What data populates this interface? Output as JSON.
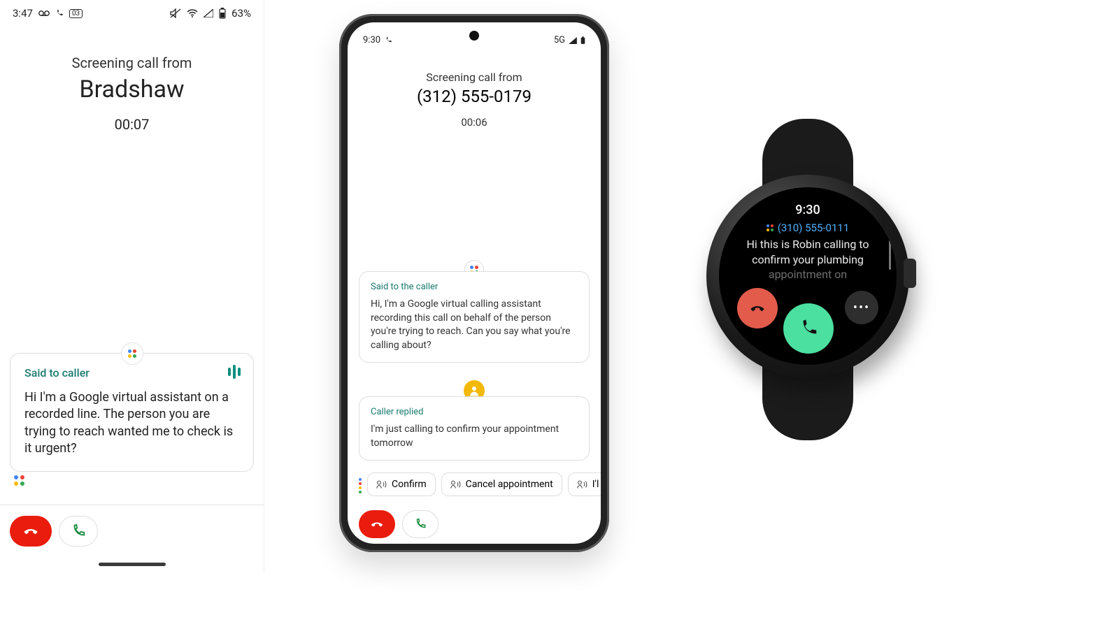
{
  "left": {
    "status": {
      "time": "3:47",
      "battery": "63%"
    },
    "title": "Screening call from",
    "caller": "Bradshaw",
    "timer": "00:07",
    "card": {
      "label": "Said to caller",
      "body": "Hi I'm a Google virtual assistant on a recorded line. The person you are trying to reach wanted me to check is it urgent?"
    }
  },
  "center": {
    "status": {
      "time": "9:30",
      "net": "5G"
    },
    "title": "Screening call from",
    "caller": "(312) 555-0179",
    "timer": "00:06",
    "said": {
      "label": "Said to the caller",
      "body": "Hi, I'm a Google virtual calling assistant recording this call on behalf of the person you're trying to reach. Can you say what you're calling about?"
    },
    "reply": {
      "label": "Caller replied",
      "body": "I'm just calling to confirm your appointment tomorrow"
    },
    "chips": {
      "confirm": "Confirm",
      "cancel": "Cancel appointment",
      "third": "I'l"
    }
  },
  "watch": {
    "time": "9:30",
    "number": "(310) 555-0111",
    "msg_line1": "Hi this is Robin calling to",
    "msg_line2": "confirm your plumbing",
    "msg_fade": "appointment on",
    "more": "•••"
  },
  "colors": {
    "decline": "#ea1c0d",
    "answer": "#158a3a",
    "teal": "#1b7b6e",
    "watch_red": "#e25b4b",
    "watch_green": "#4bdfa0"
  }
}
